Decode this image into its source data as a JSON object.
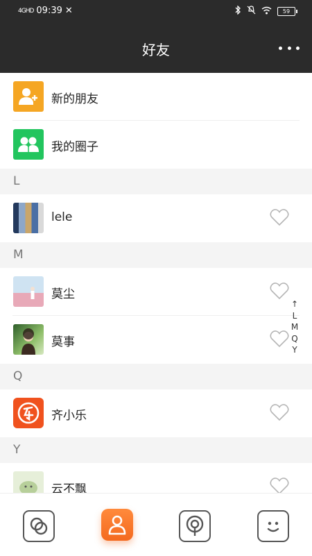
{
  "status_bar": {
    "signal": "4GHD",
    "time": "09:39",
    "battery": "59"
  },
  "header": {
    "title": "好友"
  },
  "quick_items": [
    {
      "label": "新的朋友",
      "icon": "add-friend-icon",
      "color": "#f5a623"
    },
    {
      "label": "我的圈子",
      "icon": "group-icon",
      "color": "#22c55e"
    }
  ],
  "sections": [
    {
      "letter": "L",
      "contacts": [
        {
          "name": "lele"
        }
      ]
    },
    {
      "letter": "M",
      "contacts": [
        {
          "name": "莫尘"
        },
        {
          "name": "莫事"
        }
      ]
    },
    {
      "letter": "Q",
      "contacts": [
        {
          "name": "齐小乐"
        }
      ]
    },
    {
      "letter": "Y",
      "contacts": [
        {
          "name": "云不飘"
        }
      ]
    }
  ],
  "index_bar": [
    "↑",
    "L",
    "M",
    "Q",
    "Y"
  ],
  "tabs": [
    {
      "icon": "circles-icon",
      "active": false
    },
    {
      "icon": "person-icon",
      "active": true
    },
    {
      "icon": "location-icon",
      "active": false
    },
    {
      "icon": "smiley-icon",
      "active": false
    }
  ],
  "colors": {
    "header_bg": "#2b2b2b",
    "accent": "#f46a1f",
    "section_bg": "#f4f4f4"
  }
}
